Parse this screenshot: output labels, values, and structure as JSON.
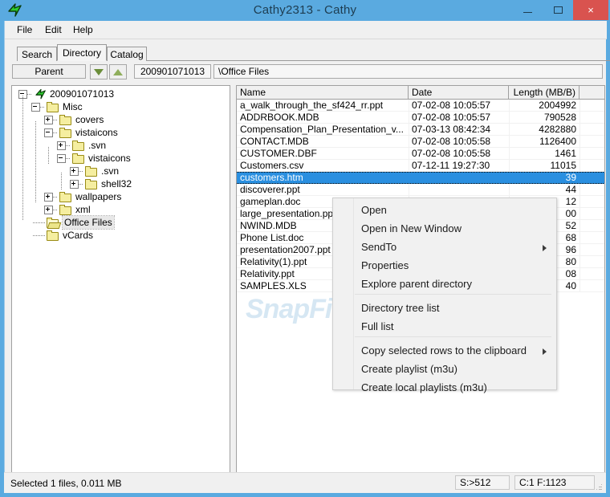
{
  "window": {
    "title": "Cathy2313 - Cathy",
    "app_icon": "green-arrow-icon",
    "minimize_label": "Minimize",
    "maximize_label": "Maximize",
    "close_label": "×"
  },
  "menubar": {
    "items": [
      "File",
      "Edit",
      "Help"
    ]
  },
  "tabs": [
    {
      "label": "Search",
      "active": false
    },
    {
      "label": "Directory",
      "active": true
    },
    {
      "label": "Catalog",
      "active": false
    }
  ],
  "toolbar": {
    "parent_label": "Parent",
    "down_icon": "arrow-down-icon",
    "up_icon": "arrow-up-icon",
    "volume_value": "200901071013",
    "path_value": "\\Office Files"
  },
  "tree": {
    "nodes": [
      {
        "label": "200901071013",
        "depth": 0,
        "toggle": "minus",
        "icon": "volume-icon",
        "selected": false
      },
      {
        "label": "Misc",
        "depth": 1,
        "toggle": "minus",
        "icon": "folder-closed-icon",
        "selected": false
      },
      {
        "label": "covers",
        "depth": 2,
        "toggle": "plus",
        "icon": "folder-closed-icon",
        "selected": false
      },
      {
        "label": "vistaicons",
        "depth": 2,
        "toggle": "minus",
        "icon": "folder-closed-icon",
        "selected": false
      },
      {
        "label": ".svn",
        "depth": 3,
        "toggle": "plus",
        "icon": "folder-closed-icon",
        "selected": false
      },
      {
        "label": "vistaicons",
        "depth": 3,
        "toggle": "minus",
        "icon": "folder-closed-icon",
        "selected": false
      },
      {
        "label": ".svn",
        "depth": 4,
        "toggle": "plus",
        "icon": "folder-closed-icon",
        "selected": false
      },
      {
        "label": "shell32",
        "depth": 4,
        "toggle": "plus",
        "icon": "folder-closed-icon",
        "selected": false
      },
      {
        "label": "wallpapers",
        "depth": 2,
        "toggle": "plus",
        "icon": "folder-closed-icon",
        "selected": false
      },
      {
        "label": "xml",
        "depth": 2,
        "toggle": "plus",
        "icon": "folder-closed-icon",
        "selected": false
      },
      {
        "label": "Office Files",
        "depth": 1,
        "toggle": "none",
        "icon": "folder-open-icon",
        "selected": true
      },
      {
        "label": "vCards",
        "depth": 1,
        "toggle": "none",
        "icon": "folder-closed-icon",
        "selected": false
      }
    ]
  },
  "filelist": {
    "columns": [
      "Name",
      "Date",
      "Length (MB/B)"
    ],
    "rows": [
      {
        "name": "a_walk_through_the_sf424_rr.ppt",
        "date": "07-02-08 10:05:57",
        "length": "2004992",
        "selected": false
      },
      {
        "name": "ADDRBOOK.MDB",
        "date": "07-02-08 10:05:57",
        "length": "790528",
        "selected": false
      },
      {
        "name": "Compensation_Plan_Presentation_v...",
        "date": "07-03-13 08:42:34",
        "length": "4282880",
        "selected": false
      },
      {
        "name": "CONTACT.MDB",
        "date": "07-02-08 10:05:58",
        "length": "1126400",
        "selected": false
      },
      {
        "name": "CUSTOMER.DBF",
        "date": "07-02-08 10:05:58",
        "length": "1461",
        "selected": false
      },
      {
        "name": "Customers.csv",
        "date": "07-12-11 19:27:30",
        "length": "11015",
        "selected": false
      },
      {
        "name": "customers.htm",
        "date": "",
        "length": "39",
        "selected": true
      },
      {
        "name": "discoverer.ppt",
        "date": "",
        "length": "44",
        "selected": false
      },
      {
        "name": "gameplan.doc",
        "date": "",
        "length": "12",
        "selected": false
      },
      {
        "name": "large_presentation.ppt",
        "date": "",
        "length": "00",
        "selected": false
      },
      {
        "name": "NWIND.MDB",
        "date": "",
        "length": "52",
        "selected": false
      },
      {
        "name": "Phone List.doc",
        "date": "",
        "length": "68",
        "selected": false
      },
      {
        "name": "presentation2007.ppt",
        "date": "",
        "length": "96",
        "selected": false
      },
      {
        "name": "Relativity(1).ppt",
        "date": "",
        "length": "80",
        "selected": false
      },
      {
        "name": "Relativity.ppt",
        "date": "",
        "length": "08",
        "selected": false
      },
      {
        "name": "SAMPLES.XLS",
        "date": "",
        "length": "40",
        "selected": false
      }
    ]
  },
  "context_menu": {
    "items": [
      {
        "label": "Open",
        "submenu": false
      },
      {
        "label": "Open in New Window",
        "submenu": false
      },
      {
        "label": "SendTo",
        "submenu": true
      },
      {
        "label": "Properties",
        "submenu": false
      },
      {
        "label": "Explore parent directory",
        "submenu": false
      },
      {
        "label": "Directory tree list",
        "submenu": false
      },
      {
        "label": "Full list",
        "submenu": false
      },
      {
        "label": "Copy selected rows to the clipboard",
        "submenu": true
      },
      {
        "label": "Create playlist (m3u)",
        "submenu": false
      },
      {
        "label": "Create local playlists (m3u)",
        "submenu": false
      }
    ]
  },
  "scrollbar": {
    "left_icon": "‹",
    "right_icon": "›"
  },
  "statusbar": {
    "text": "Selected 1 files, 0.011 MB",
    "cell_a": "S:>512",
    "cell_b": "C:1 F:1123"
  },
  "watermark": {
    "text": "SnapFiles"
  },
  "colors": {
    "title_bg": "#5aaae0",
    "close_btn": "#d9534f",
    "selection": "#2a8fe0",
    "client_bg": "#f0f0f0"
  }
}
